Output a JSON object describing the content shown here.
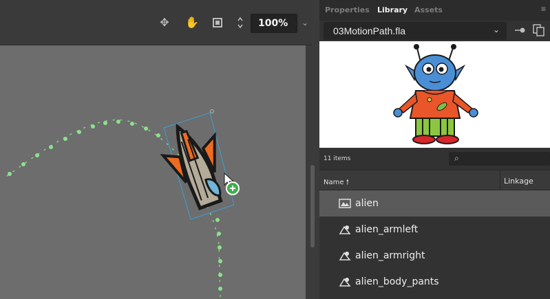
{
  "toolbar": {
    "icons": [
      "snap-icon",
      "hand-icon",
      "clip-icon",
      "stepper-icon"
    ],
    "zoom_value": "100%"
  },
  "panel": {
    "tabs": [
      {
        "label": "Properties",
        "active": false
      },
      {
        "label": "Library",
        "active": true
      },
      {
        "label": "Assets",
        "active": false
      }
    ],
    "file_name": "03MotionPath.fla",
    "item_count": "11 items",
    "columns": {
      "name": "Name",
      "linkage": "Linkage"
    },
    "items": [
      {
        "label": "alien",
        "type": "movie-clip",
        "selected": true
      },
      {
        "label": "alien_armleft",
        "type": "graphic",
        "selected": false
      },
      {
        "label": "alien_armright",
        "type": "graphic",
        "selected": false
      },
      {
        "label": "alien_body_pants",
        "type": "graphic",
        "selected": false
      }
    ]
  },
  "colors": {
    "stage": "#6d6d6d",
    "motion_path": "#7cd27c",
    "selection": "#3aa0d8",
    "add_badge": "#3fb04b"
  }
}
